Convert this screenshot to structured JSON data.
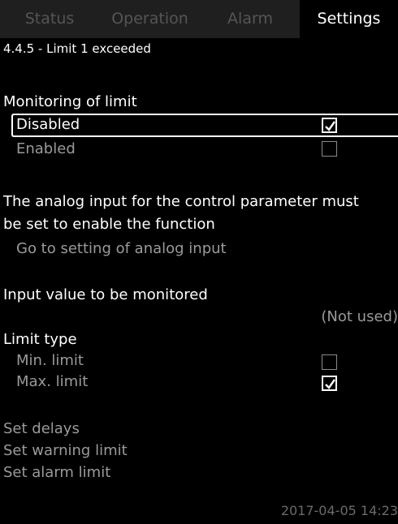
{
  "tabs": [
    "Status",
    "Operation",
    "Alarm",
    "Settings"
  ],
  "breadcrumb": "4.4.5 - Limit 1 exceeded",
  "monitoring": {
    "heading": "Monitoring of limit",
    "options": [
      {
        "label": "Disabled",
        "checked": true
      },
      {
        "label": "Enabled",
        "checked": false
      }
    ]
  },
  "info": {
    "line1": "The analog input for the control parameter must",
    "line2": "be set to enable the function",
    "link": "Go to setting of analog input"
  },
  "input": {
    "heading": "Input value to be monitored",
    "value": "(Not used)"
  },
  "limit_type": {
    "heading": "Limit type",
    "options": [
      {
        "label": "Min. limit",
        "checked": false
      },
      {
        "label": "Max. limit",
        "checked": true
      }
    ]
  },
  "actions": [
    "Set delays",
    "Set warning limit",
    "Set alarm limit"
  ],
  "timestamp": "2017-04-05 14:23"
}
